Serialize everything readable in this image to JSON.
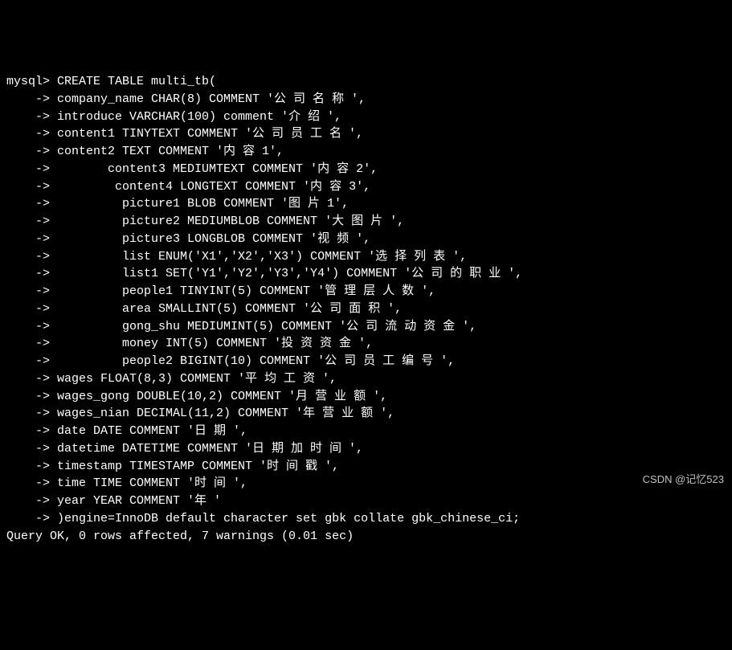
{
  "prompt": "mysql> ",
  "continuation": "    -> ",
  "lines": [
    "CREATE TABLE multi_tb(",
    "company_name CHAR(8) COMMENT '公 司 名 称 ',",
    "introduce VARCHAR(100) comment '介 绍 ',",
    "content1 TINYTEXT COMMENT '公 司 员 工 名 ',",
    "content2 TEXT COMMENT '内 容 1',",
    "       content3 MEDIUMTEXT COMMENT '内 容 2',",
    "        content4 LONGTEXT COMMENT '内 容 3',",
    "         picture1 BLOB COMMENT '图 片 1',",
    "         picture2 MEDIUMBLOB COMMENT '大 图 片 ',",
    "         picture3 LONGBLOB COMMENT '视 频 ',",
    "         list ENUM('X1','X2','X3') COMMENT '选 择 列 表 ',",
    "         list1 SET('Y1','Y2','Y3','Y4') COMMENT '公 司 的 职 业 ',",
    "         people1 TINYINT(5) COMMENT '管 理 层 人 数 ',",
    "         area SMALLINT(5) COMMENT '公 司 面 积 ',",
    "         gong_shu MEDIUMINT(5) COMMENT '公 司 流 动 资 金 ',",
    "         money INT(5) COMMENT '投 资 资 金 ',",
    "         people2 BIGINT(10) COMMENT '公 司 员 工 编 号 ',",
    "wages FLOAT(8,3) COMMENT '平 均 工 资 ',",
    "wages_gong DOUBLE(10,2) COMMENT '月 营 业 额 ',",
    "wages_nian DECIMAL(11,2) COMMENT '年 营 业 额 ',",
    "date DATE COMMENT '日 期 ',",
    "datetime DATETIME COMMENT '日 期 加 时 间 ',",
    "timestamp TIMESTAMP COMMENT '时 间 戳 ',",
    "time TIME COMMENT '时 间 ',",
    "year YEAR COMMENT '年 '",
    ")engine=InnoDB default character set gbk collate gbk_chinese_ci;"
  ],
  "result": "Query OK, 0 rows affected, 7 warnings (0.01 sec)",
  "watermark": "CSDN @记忆523"
}
